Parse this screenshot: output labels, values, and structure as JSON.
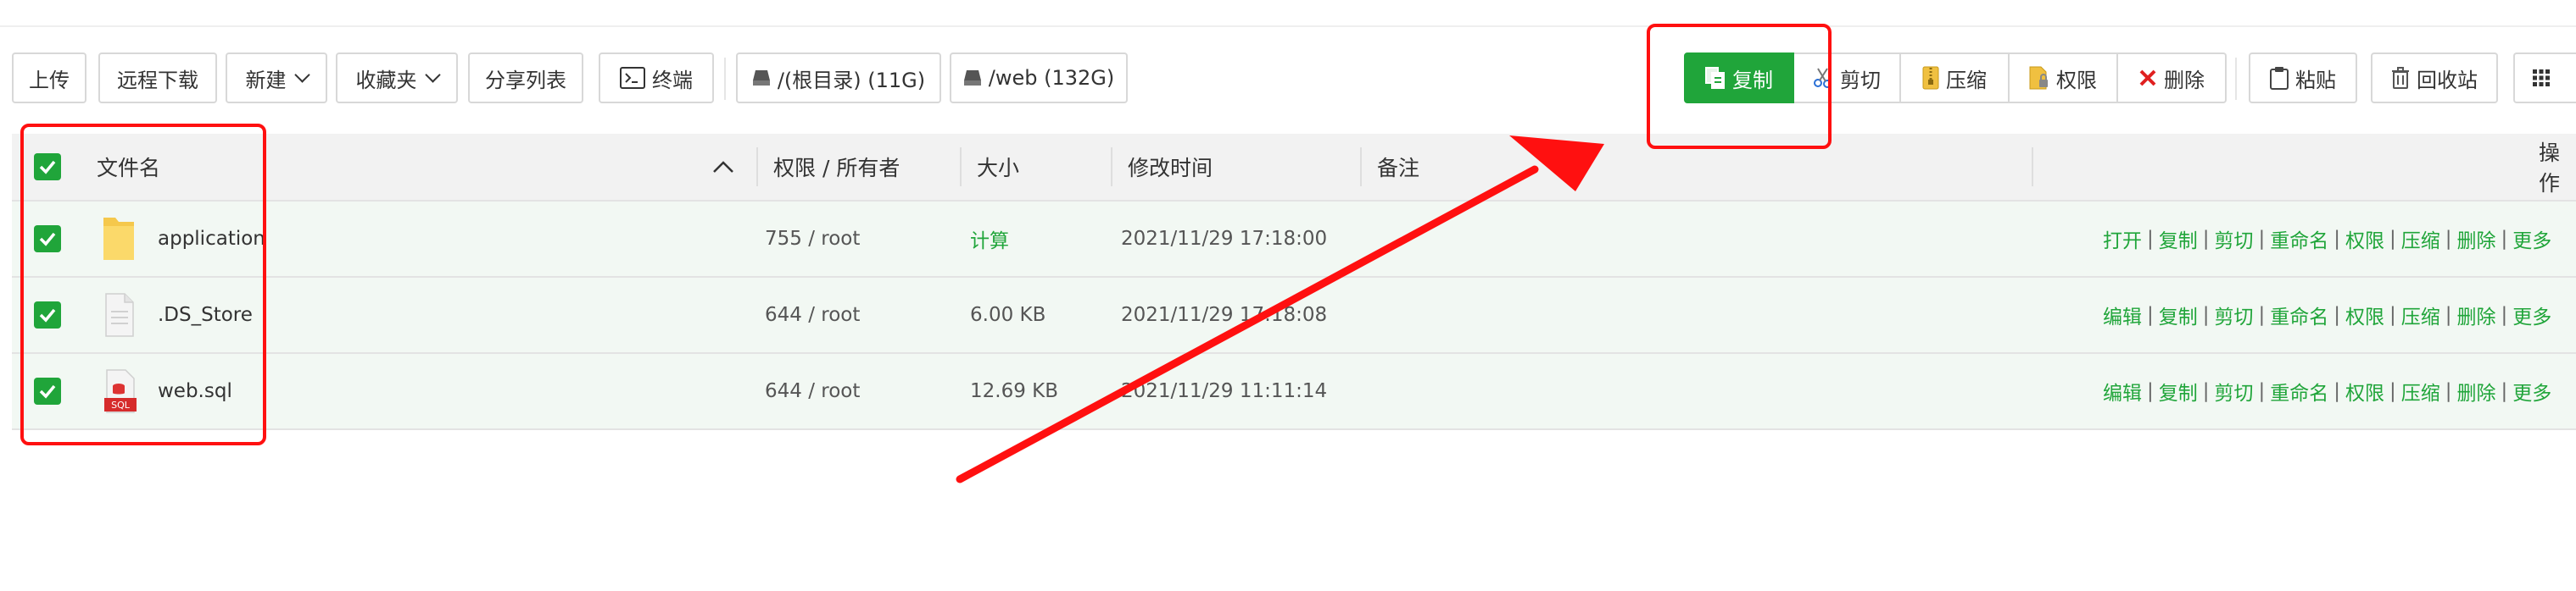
{
  "toolbar": {
    "upload": "上传",
    "remote_download": "远程下载",
    "new": "新建",
    "favorites": "收藏夹",
    "share_list": "分享列表",
    "terminal": "终端",
    "disk_root": "/(根目录) (11G)",
    "disk_web": "/web (132G)",
    "copy": "复制",
    "cut": "剪切",
    "compress": "压缩",
    "permission": "权限",
    "delete": "删除",
    "paste": "粘贴",
    "recycle_bin": "回收站"
  },
  "table": {
    "headers": {
      "filename": "文件名",
      "perm_owner": "权限 / 所有者",
      "size": "大小",
      "modified": "修改时间",
      "remark": "备注",
      "actions": "操作"
    },
    "rows": [
      {
        "name": "application",
        "type": "folder",
        "perm": "755 / root",
        "size": "计算",
        "modified": "2021/11/29 17:18:00",
        "ops": [
          "打开",
          "复制",
          "剪切",
          "重命名",
          "权限",
          "压缩",
          "删除",
          "更多"
        ]
      },
      {
        "name": ".DS_Store",
        "type": "file",
        "perm": "644 / root",
        "size": "6.00 KB",
        "modified": "2021/11/29 17:18:08",
        "ops": [
          "编辑",
          "复制",
          "剪切",
          "重命名",
          "权限",
          "压缩",
          "删除",
          "更多"
        ]
      },
      {
        "name": "web.sql",
        "type": "sql",
        "perm": "644 / root",
        "size": "12.69 KB",
        "modified": "2021/11/29 11:11:14",
        "ops": [
          "编辑",
          "复制",
          "剪切",
          "重命名",
          "权限",
          "压缩",
          "删除",
          "更多"
        ]
      }
    ]
  },
  "icons": {
    "sql_label": "SQL"
  },
  "colors": {
    "accent": "#20a53a",
    "annotation": "#ff1010",
    "row_bg": "#f2f8f3",
    "header_bg": "#f2f2f2"
  }
}
